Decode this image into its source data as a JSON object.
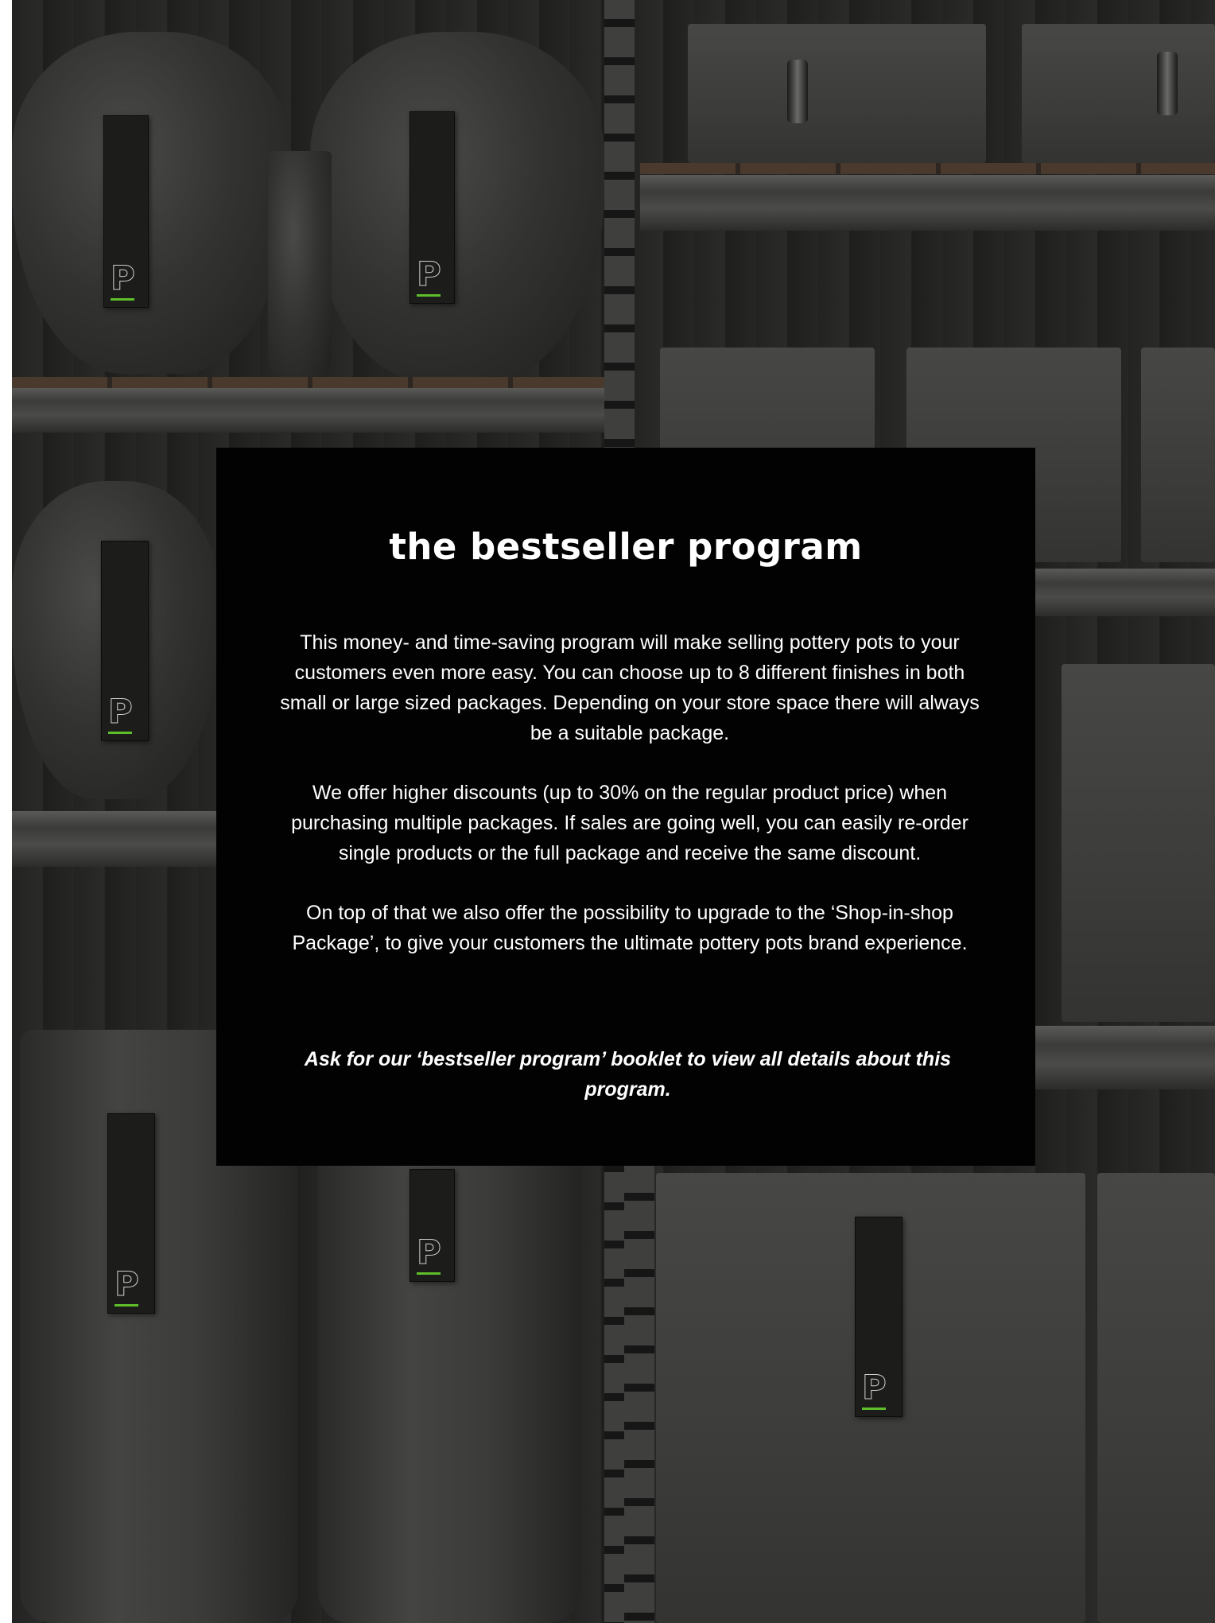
{
  "panel": {
    "title": "the bestseller program",
    "paragraphs": [
      "This money- and time-saving program will make selling pottery pots to your customers even more easy. You can choose up to 8 different finishes in both small or large sized packages. Depending on your store space there will always be a suitable package.",
      "We offer higher discounts (up to 30% on the regular product price) when purchasing multiple packages. If sales are going well, you can easily re-order single products or the full package and receive the same discount.",
      "On top of that we also offer the possibility to upgrade to the ‘Shop-in-shop Package’, to give your customers the ultimate pottery pots brand experience."
    ],
    "call_to_action": "Ask for our ‘bestseller program’ booklet to view all details about this program."
  },
  "background": {
    "description_icon": "pottery-shelves-photo",
    "tag_logo_glyph": "P",
    "colors": {
      "panel": "#020202",
      "text": "#ffffff",
      "tag_accent": "#5fbf2a"
    }
  }
}
